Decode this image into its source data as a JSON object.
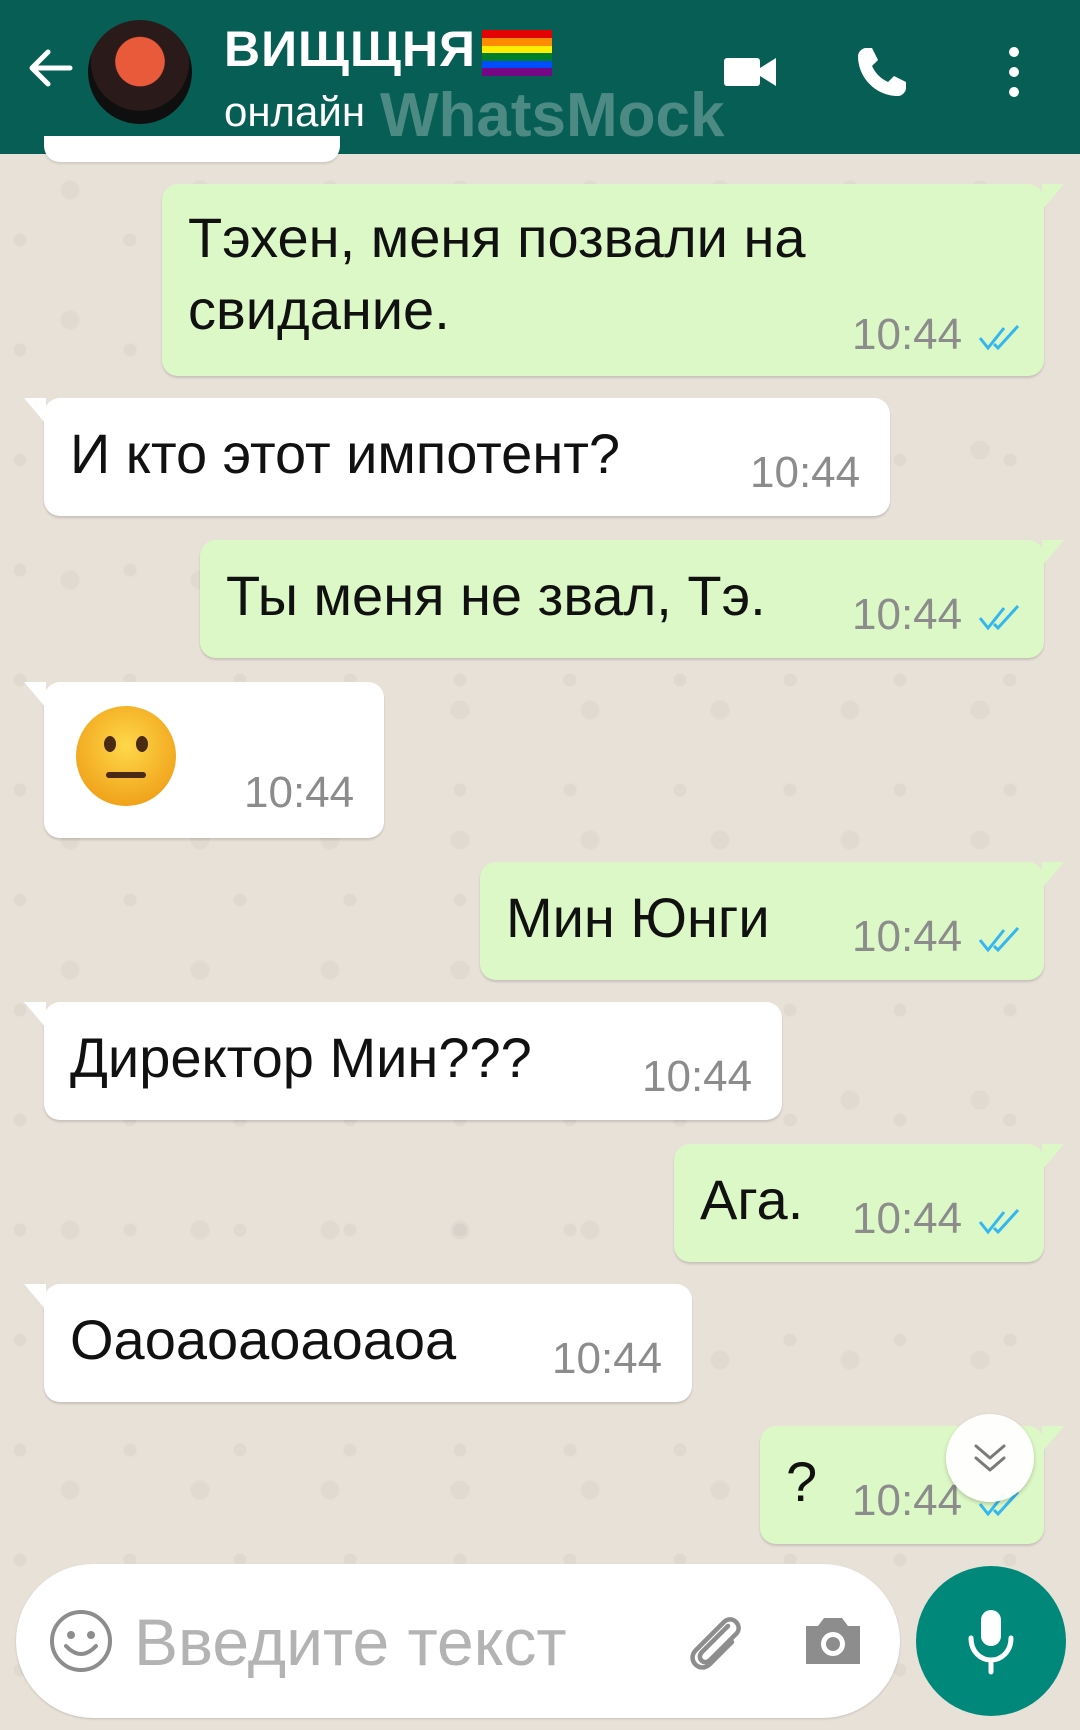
{
  "header": {
    "contact_name": "ВИЩЩНЯ",
    "status": "онлайн",
    "watermark": "WhatsMock",
    "icons": [
      "back-arrow-icon",
      "avatar",
      "rainbow-flag-icon",
      "video-call-icon",
      "phone-icon",
      "more-vert-icon"
    ]
  },
  "messages": [
    {
      "direction": "out",
      "text_lines": [
        "Тэхен, меня позвали на",
        "свидание."
      ],
      "time": "10:44",
      "read": true
    },
    {
      "direction": "in",
      "text": "И кто этот импотент?",
      "time": "10:44"
    },
    {
      "direction": "out",
      "text": "Ты меня не звал, Тэ.",
      "time": "10:44",
      "read": true
    },
    {
      "direction": "in",
      "emoji": "neutral-face-emoji",
      "time": "10:44"
    },
    {
      "direction": "out",
      "text": "Мин Юнги",
      "time": "10:44",
      "read": true
    },
    {
      "direction": "in",
      "text": "Директор Мин???",
      "time": "10:44"
    },
    {
      "direction": "out",
      "text": "Ага.",
      "time": "10:44",
      "read": true
    },
    {
      "direction": "in",
      "text": "Оаоаоаоаоаоа",
      "time": "10:44"
    },
    {
      "direction": "out",
      "text": "?",
      "time": "10:44",
      "read": true
    }
  ],
  "composer": {
    "placeholder": "Введите текст",
    "icons": [
      "emoji-icon",
      "attach-icon",
      "camera-icon",
      "mic-icon"
    ]
  },
  "colors": {
    "header_bg": "#075e54",
    "outgoing_bubble": "#dcf8c6",
    "incoming_bubble": "#ffffff",
    "read_ticks": "#34b7f1",
    "mic_button": "#00897b"
  }
}
